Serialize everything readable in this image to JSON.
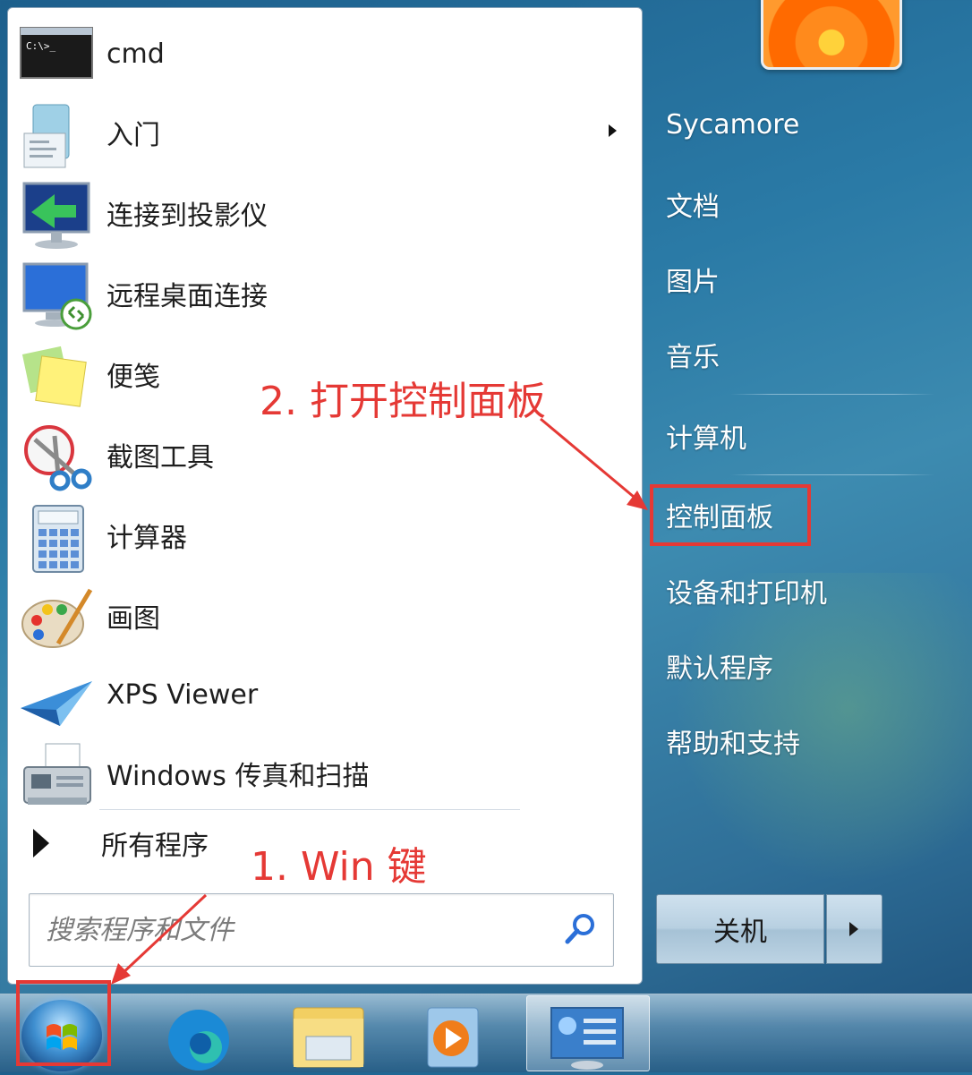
{
  "start_menu": {
    "programs": [
      {
        "label": "cmd",
        "icon": "cmd-icon"
      },
      {
        "label": "入门",
        "icon": "getting-started-icon",
        "has_submenu": true
      },
      {
        "label": "连接到投影仪",
        "icon": "projector-icon"
      },
      {
        "label": "远程桌面连接",
        "icon": "remote-desktop-icon"
      },
      {
        "label": "便笺",
        "icon": "sticky-notes-icon"
      },
      {
        "label": "截图工具",
        "icon": "snipping-tool-icon"
      },
      {
        "label": "计算器",
        "icon": "calculator-icon"
      },
      {
        "label": "画图",
        "icon": "paint-icon"
      },
      {
        "label": "XPS Viewer",
        "icon": "xps-viewer-icon"
      },
      {
        "label": "Windows 传真和扫描",
        "icon": "fax-scan-icon"
      }
    ],
    "all_programs": "所有程序",
    "search_placeholder": "搜索程序和文件"
  },
  "right_menu": {
    "user_name": "Sycamore",
    "items": [
      "文档",
      "图片",
      "音乐",
      "计算机",
      "控制面板",
      "设备和打印机",
      "默认程序",
      "帮助和支持"
    ],
    "shutdown_label": "关机"
  },
  "annotations": {
    "step1": "1. Win 键",
    "step2": "2. 打开控制面板",
    "color": "#e53935"
  },
  "taskbar": {
    "icons": [
      "start-orb-icon",
      "edge-icon",
      "file-explorer-icon",
      "media-player-icon",
      "control-panel-icon"
    ]
  }
}
